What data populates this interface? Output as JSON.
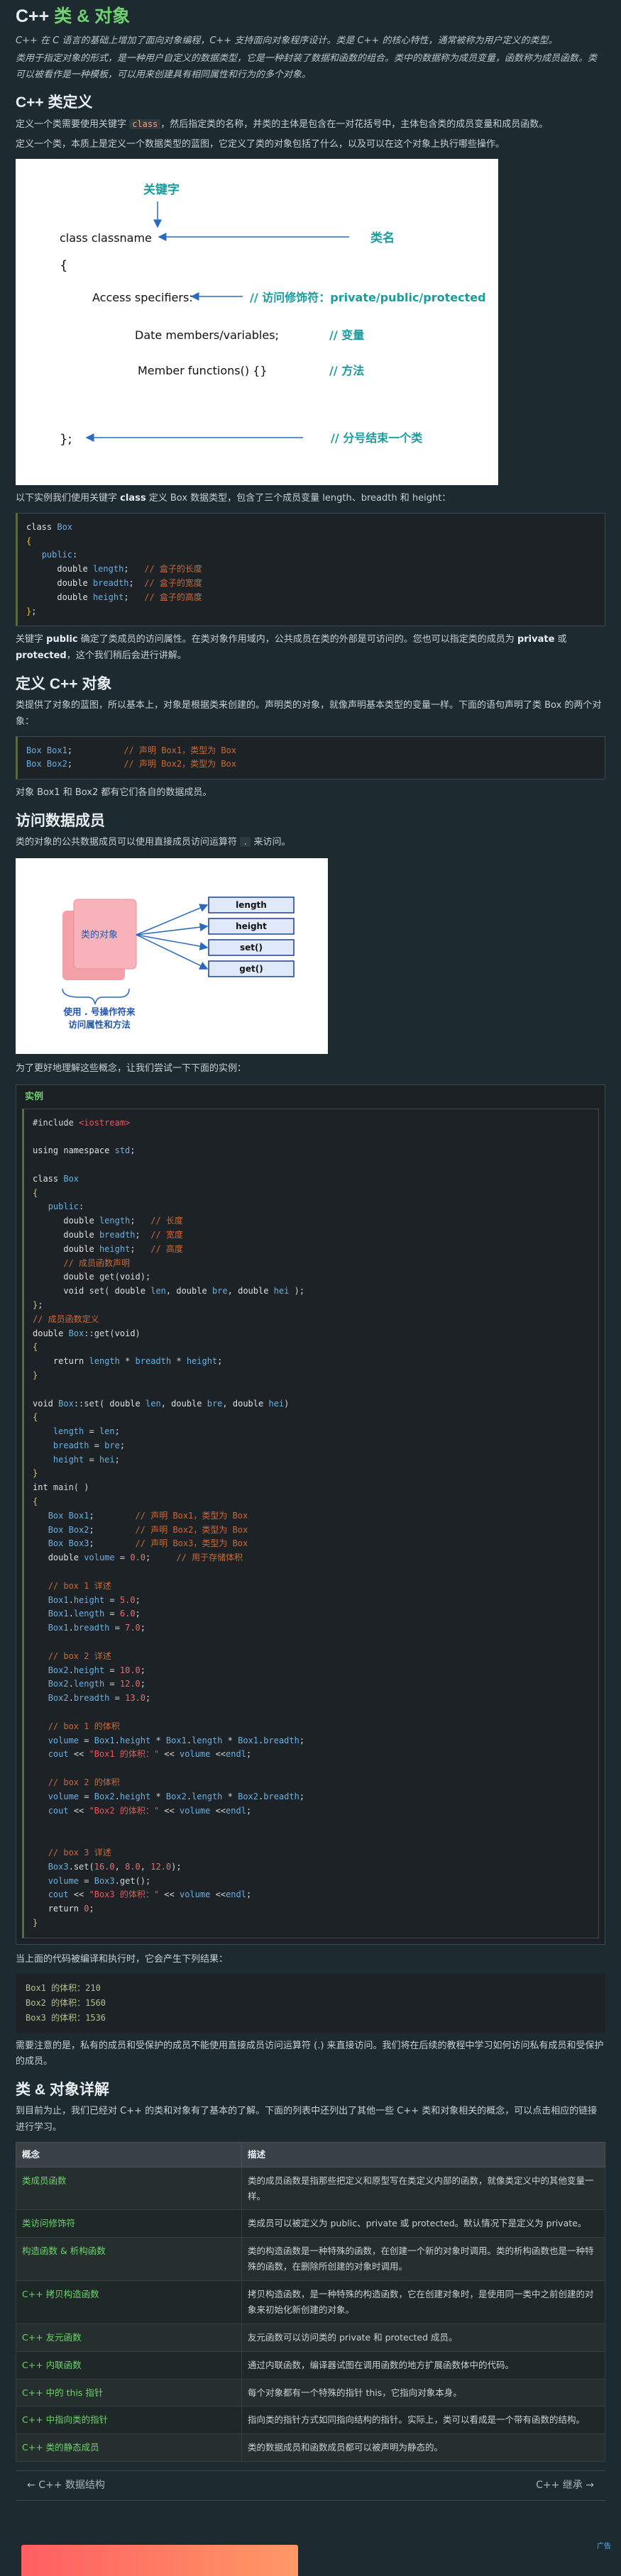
{
  "title": {
    "prefix": "C++",
    "highlight": "类 & 对象"
  },
  "intro": "C++ 在 C 语言的基础上增加了面向对象编程，C++ 支持面向对象程序设计。类是 C++ 的核心特性，通常被称为用户定义的类型。",
  "intro2": "类用于指定对象的形式，是一种用户自定义的数据类型，它是一种封装了数据和函数的组合。类中的数据称为成员变量，函数称为成员函数。类可以被看作是一种模板，可以用来创建具有相同属性和行为的多个对象。",
  "section_def": {
    "heading": "C++ 类定义",
    "p1_a": "定义一个类需要使用关键字",
    "p1_kw": "class",
    "p1_b": "，然后指定类的名称，并类的主体是包含在一对花括号中，主体包含类的成员变量和成员函数。",
    "p2": "定义一个类，本质上是定义一个数据类型的蓝图，它定义了类的对象包括了什么，以及可以在这个对象上执行哪些操作。"
  },
  "diagram1": {
    "keyword_label": "关键字",
    "class_line": "class classname",
    "classname_label": "类名",
    "brace_open": "{",
    "access_line": "Access specifiers:",
    "access_label": "// 访问修饰符：private/public/protected",
    "members_line": "Date members/variables;",
    "members_label": "// 变量",
    "functions_line": "Member functions() {}",
    "functions_label": "// 方法",
    "brace_close": "};",
    "end_label": "// 分号结束一个类"
  },
  "box_intro": {
    "a": "以下实例我们使用关键字",
    "kw": "class",
    "b": "定义 Box 数据类型，包含了三个成员变量 length、breadth 和 height："
  },
  "public_note": {
    "a": "关键字",
    "kw1": "public",
    "b": "确定了类成员的访问属性。在类对象作用域内，公共成员在类的外部是可访问的。您也可以指定类的成员为",
    "kw2": "private",
    "c": "或",
    "kw3": "protected",
    "d": "，这个我们稍后会进行讲解。"
  },
  "section_obj": {
    "heading": "定义 C++ 对象",
    "p1": "类提供了对象的蓝图，所以基本上，对象是根据类来创建的。声明类的对象，就像声明基本类型的变量一样。下面的语句声明了类 Box 的两个对象：",
    "p2": "对象 Box1 和 Box2 都有它们各自的数据成员。"
  },
  "section_access": {
    "heading": "访问数据成员",
    "p1_a": "类的对象的公共数据成员可以使用直接成员访问运算符",
    "p1_kw": ".",
    "p1_b": "来访问。",
    "p2": "为了更好地理解这些概念，让我们尝试一下下面的实例："
  },
  "diagram2": {
    "object_label": "类的对象",
    "members": [
      "length",
      "height",
      "set()",
      "get()"
    ],
    "caption_line1": "使用 . 号操作符来",
    "caption_line2": "访问属性和方法"
  },
  "example": {
    "title": "实例"
  },
  "output": {
    "intro": "当上面的代码被编译和执行时，它会产生下列结果：",
    "lines": [
      "Box1 的体积：210",
      "Box2 的体积：1560",
      "Box3 的体积：1536"
    ]
  },
  "private_note": "需要注意的是，私有的成员和受保护的成员不能使用直接成员访问运算符 (.) 来直接访问。我们将在后续的教程中学习如何访问私有成员和受保护的成员。",
  "section_detail": {
    "heading": "类 & 对象详解",
    "p1": "到目前为止，我们已经对 C++ 的类和对象有了基本的了解。下面的列表中还列出了其他一些 C++ 类和对象相关的概念，可以点击相应的链接进行学习。",
    "col_concept": "概念",
    "col_desc": "描述",
    "rows": [
      {
        "concept": "类成员函数",
        "desc": "类的成员函数是指那些把定义和原型写在类定义内部的函数，就像类定义中的其他变量一样。"
      },
      {
        "concept": "类访问修饰符",
        "desc": "类成员可以被定义为 public、private 或 protected。默认情况下是定义为 private。"
      },
      {
        "concept": "构造函数 & 析构函数",
        "desc": "类的构造函数是一种特殊的函数，在创建一个新的对象时调用。类的析构函数也是一种特殊的函数，在删除所创建的对象时调用。"
      },
      {
        "concept": "C++ 拷贝构造函数",
        "desc": "拷贝构造函数，是一种特殊的构造函数，它在创建对象时，是使用同一类中之前创建的对象来初始化新创建的对象。"
      },
      {
        "concept": "C++ 友元函数",
        "desc": "友元函数可以访问类的 private 和 protected 成员。"
      },
      {
        "concept": "C++ 内联函数",
        "desc": "通过内联函数，编译器试图在调用函数的地方扩展函数体中的代码。"
      },
      {
        "concept": "C++ 中的 this 指针",
        "desc": "每个对象都有一个特殊的指针 this，它指向对象本身。"
      },
      {
        "concept": "C++ 中指向类的指针",
        "desc": "指向类的指针方式如同指向结构的指针。实际上，类可以看成是一个带有函数的结构。"
      },
      {
        "concept": "C++ 类的静态成员",
        "desc": "类的数据成员和函数成员都可以被声明为静态的。"
      }
    ]
  },
  "nav": {
    "prev": "C++ 数据结构",
    "next": "C++ 继承"
  },
  "ad_label": "广告",
  "colors": {
    "accent": "#6fd16f",
    "background": "#1d2a30",
    "diagram_arrow": "#2a6abf",
    "diagram_teal": "#1a9c9c",
    "object_fill": "#f5a0a8"
  }
}
